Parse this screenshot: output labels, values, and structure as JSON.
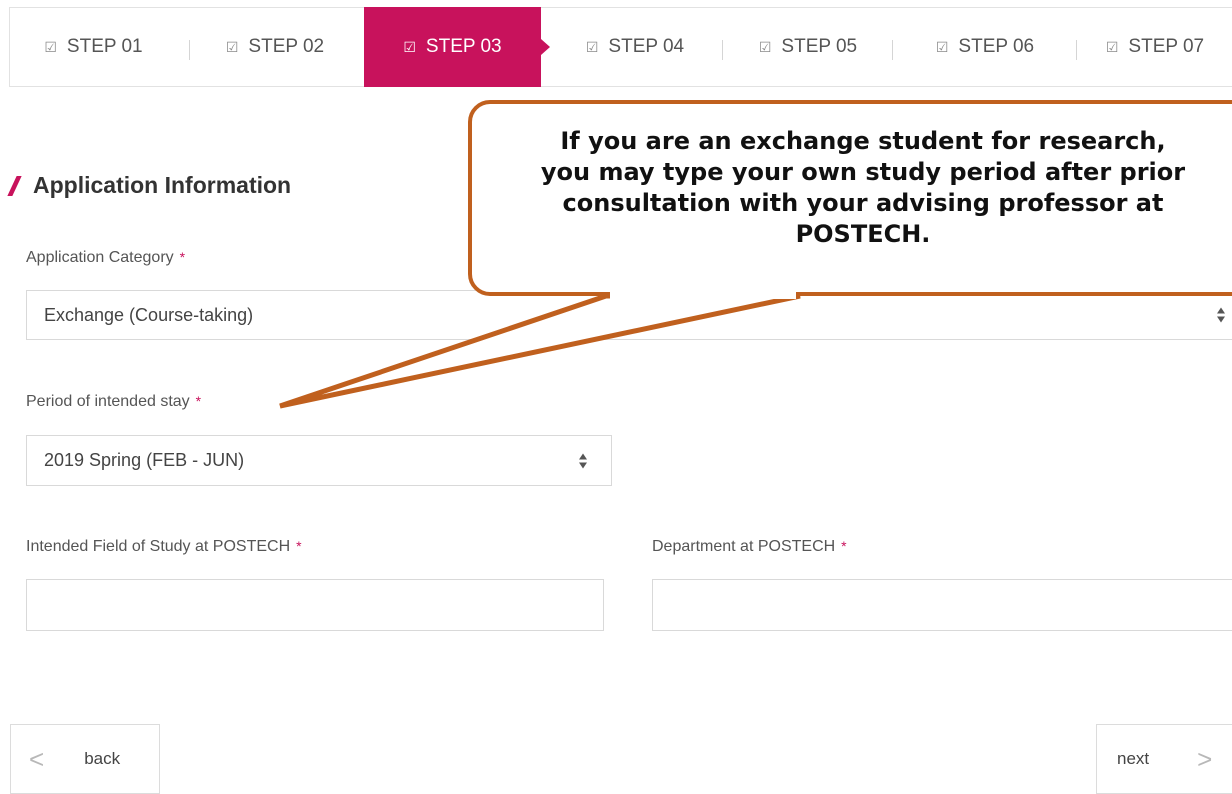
{
  "steps": [
    {
      "label": "STEP 01",
      "active": false
    },
    {
      "label": "STEP 02",
      "active": false
    },
    {
      "label": "STEP 03",
      "active": true
    },
    {
      "label": "STEP 04",
      "active": false
    },
    {
      "label": "STEP 05",
      "active": false
    },
    {
      "label": "STEP 06",
      "active": false
    },
    {
      "label": "STEP 07",
      "active": false
    }
  ],
  "step_check_glyph": "☑",
  "section": {
    "title": "Application Information"
  },
  "fields": {
    "category": {
      "label": "Application Category",
      "value": "Exchange (Course-taking)"
    },
    "period": {
      "label": "Period of intended stay",
      "value": "2019 Spring (FEB - JUN)"
    },
    "field_of_study": {
      "label": "Intended Field of Study at POSTECH",
      "value": ""
    },
    "department": {
      "label": "Department at POSTECH",
      "value": ""
    }
  },
  "required_mark": "*",
  "buttons": {
    "back": "back",
    "next": "next",
    "back_chevron": "<",
    "next_chevron": ">"
  },
  "callout": {
    "text": "If you are an exchange student for research,\nyou may type your own study period after prior\nconsultation with your advising professor at\nPOSTECH."
  },
  "colors": {
    "accent": "#c8125c",
    "callout_border": "#c0601e"
  }
}
